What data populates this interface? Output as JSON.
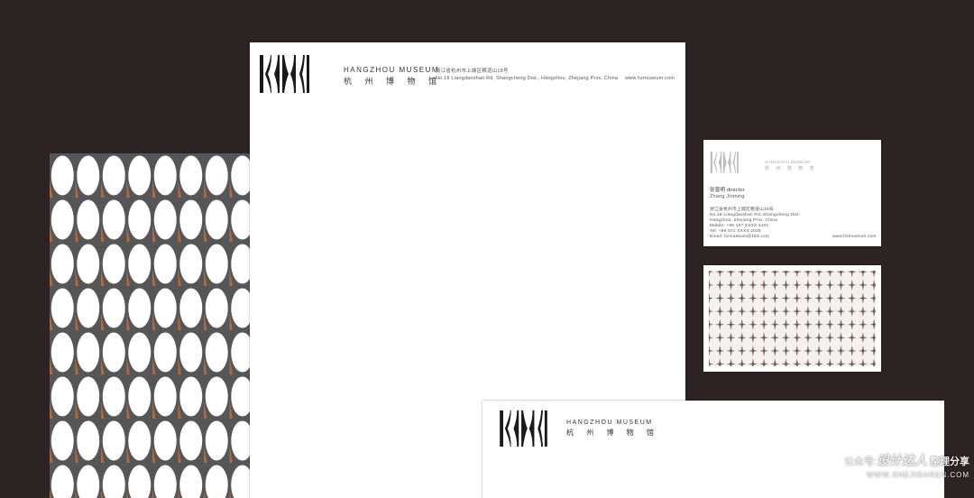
{
  "colors": {
    "background": "#2c2322",
    "paper": "#ffffff",
    "pattern_dark": "#555658",
    "pattern_accent": "#b06a3b",
    "logo_ink": "#1a1a1a"
  },
  "letterhead": {
    "logo_en": "HANGZHOU MUSEUM",
    "logo_cn": "杭 州 博 物 馆",
    "address_cn": "浙江省杭州市上城区粮道山18号",
    "address_en": "No.18 Liangdaoshan Rd, Shangcheng Dist., Hangzhou, Zhejiang Prov. China",
    "website": "www.hzmuseum.com"
  },
  "business_card": {
    "logo_en": "HANGZHOU MUSEUM",
    "logo_cn": "杭 州 博 物 馆",
    "name_line": "张晋明 director",
    "name_pinyin": "Zhang Jinming",
    "lines": [
      "浙江省杭州市上城区粮道山18号",
      "No.18 Liangdaoshan Rd, Shangcheng Dist.",
      "Hangzhou, Zhejiang Prov. China",
      "Mobile: +86 187 XXXX 1401",
      "Tel: +86 571 XXXX 2026",
      "Email: hzmuseum@163.com"
    ],
    "website": "www.hzmuseum.com"
  },
  "envelope": {
    "logo_en": "HANGZHOU MUSEUM",
    "logo_cn": "杭 州 博 物 馆"
  },
  "watermark": {
    "line1_prefix": "公众号:",
    "line1_name": "设计达人",
    "line1_suffix": "整理分享",
    "line2": "WWW.SHEJIDAREN.COM"
  }
}
